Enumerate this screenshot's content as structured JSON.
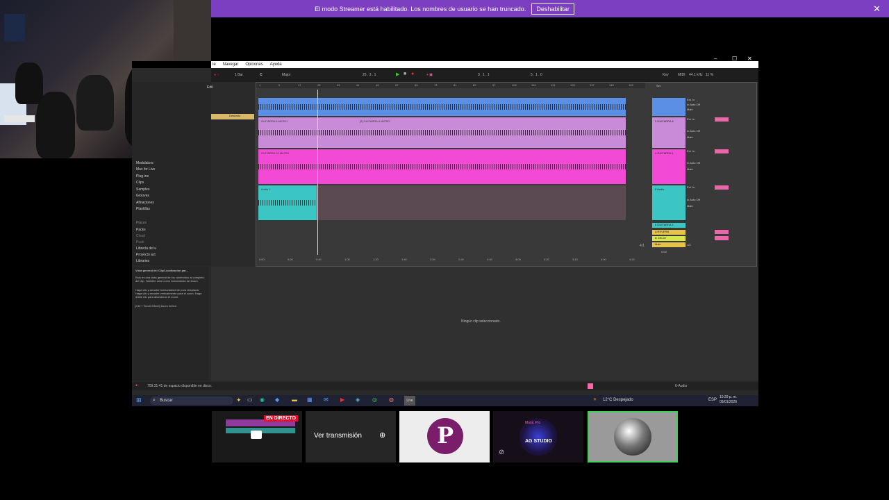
{
  "banner": {
    "message": "El modo Streamer está habilitado. Los nombres de usuario se han truncado.",
    "button": "Deshabilitar",
    "close": "✕"
  },
  "window": {
    "controls": [
      "–",
      "☐",
      "✕"
    ],
    "menu": [
      "le",
      "Navegar",
      "Opciones",
      "Ayuda"
    ]
  },
  "toolbar": {
    "bars": "1 Bar",
    "key": "C",
    "scale": "Major",
    "position": "25 . 3 . 1",
    "loop_start": "3 . 1 . 1",
    "loop_length": "5 . 1 . 0",
    "key_label": "Key",
    "midi_label": "MIDI",
    "sample_rate": "44.1 kHz",
    "cpu": "11 %"
  },
  "browser": {
    "edit": "Edit",
    "tag": "Deseado",
    "categories": [
      "Modulators",
      "Max for Live",
      "Plug-ins",
      "Clips",
      "Samples",
      "Grooves",
      "Afinaciones",
      "Plantillas"
    ],
    "places": [
      "Places",
      "Packs",
      "Cloud",
      "Push",
      "Librería del u",
      "Proyecto act",
      "Libraries"
    ]
  },
  "info": {
    "title": "Vista general del Clip/Localización par...",
    "body1": "Esto es una vista general de los contenidos al completo del clip. También sirve como herramienta de Zoom.",
    "body2": "Haga clic y arrastre horizontalmente para desplazar. Haga clic y arrastre verticalmente para el zoom. Haga doble clic para abandonar el zoom.",
    "body3": "[Ctrl + Scroll Wheel] Zoom In/Out"
  },
  "arrangement": {
    "ruler": [
      "1",
      "9",
      "17",
      "25",
      "33",
      "41",
      "49",
      "57",
      "65",
      "73",
      "81",
      "89",
      "97",
      "105",
      "113",
      "121",
      "129",
      "137",
      "145",
      "153"
    ],
    "time": [
      "0:00",
      "0:20",
      "0:40",
      "1:00",
      "1:20",
      "1:40",
      "2:00",
      "2:20",
      "2:40",
      "3:00",
      "3:20",
      "3:40",
      "4:00",
      "4:20"
    ],
    "set_label": "Set",
    "fraction": "4/1",
    "tracks": [
      {
        "name": "",
        "clip": "",
        "color": "#5b8fe6",
        "io_in": "Ext. In",
        "io_mode": "In  Auto  Off",
        "io_out": "Main"
      },
      {
        "name": "3 GUITARRA 6",
        "clip": "GUITARRA 6 MICRO",
        "clip2": "[2] GUITARRA 6 MICRO",
        "color": "#c98ad8",
        "io_in": "Ext. In",
        "io_mode": "In  Auto  Off",
        "io_out": "Main"
      },
      {
        "name": "4 GUITARRA 1",
        "clip": "GUITARRA 12 MICRO",
        "color": "#f34ad6",
        "io_in": "Ext. In",
        "io_mode": "In  Auto  Off",
        "io_out": "Main"
      },
      {
        "name": "5 Audio",
        "clip": "Audio 1",
        "color": "#3cc6c3",
        "io_in": "Ext. In",
        "io_mode": "In  Auto  Off",
        "io_out": "Main"
      }
    ],
    "returns": [
      {
        "name": "6 GUITARRA 1",
        "color": "#3cc6c3"
      },
      {
        "name": "A REVERB",
        "color": "#e6c34a"
      },
      {
        "name": "B DELAY",
        "color": "#d8e64a"
      },
      {
        "name": "Main",
        "color": "#e6c34a"
      }
    ],
    "main_out": "1/2",
    "vol": "0.00"
  },
  "clip_view": {
    "empty": "Ningún clip seleccionado."
  },
  "status": {
    "disk": "709:31:41 de espacio disponible en disco.",
    "track": "6-Audio"
  },
  "taskbar": {
    "search": "Buscar",
    "weather": "12°C  Despejado",
    "lang": "ESP",
    "time": "10:29 p. m.",
    "date": "09/01/2026"
  },
  "thumbnails": {
    "live_badge": "EN DIRECTO",
    "watch": "Ver transmisión",
    "ag_studio": "AG STUDIO",
    "ag_top": "Music Pro"
  },
  "colors": {
    "banner": "#7d3fc2",
    "blue": "#5b8fe6",
    "violet": "#c98ad8",
    "magenta": "#f34ad6",
    "teal": "#3cc6c3"
  }
}
